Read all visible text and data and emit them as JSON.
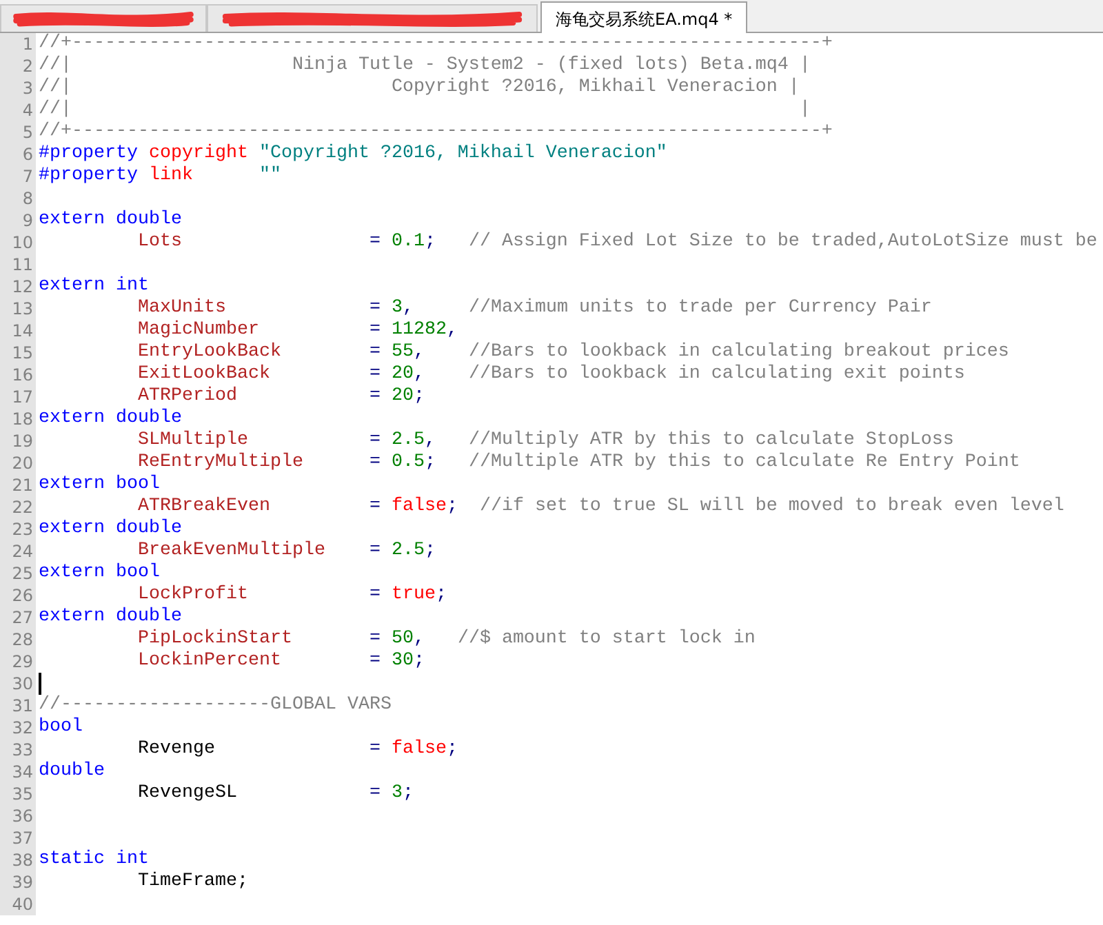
{
  "tabs": [
    {
      "selected": false,
      "redacted": true
    },
    {
      "selected": false,
      "redacted": true
    },
    {
      "label": "海龟交易系统EA.mq4 *",
      "selected": true,
      "redacted": false
    }
  ],
  "editor": {
    "lines": [
      {
        "number": "1",
        "caret": false,
        "tokens": [
          {
            "kind": "comment",
            "text": "//+--------------------------------------------------------------------+"
          }
        ]
      },
      {
        "number": "2",
        "caret": false,
        "tokens": [
          {
            "kind": "comment",
            "text": "//|                    Ninja Tutle - System2 - (fixed lots) Beta.mq4 |"
          }
        ]
      },
      {
        "number": "3",
        "caret": false,
        "tokens": [
          {
            "kind": "comment",
            "text": "//|                             Copyright ?2016, Mikhail Veneracion |"
          }
        ]
      },
      {
        "number": "4",
        "caret": false,
        "tokens": [
          {
            "kind": "comment",
            "text": "//|                                                                  |"
          }
        ]
      },
      {
        "number": "5",
        "caret": false,
        "tokens": [
          {
            "kind": "comment",
            "text": "//+--------------------------------------------------------------------+"
          }
        ]
      },
      {
        "number": "6",
        "caret": false,
        "tokens": [
          {
            "kind": "preproc",
            "text": "#property"
          },
          {
            "kind": "constant",
            "text": " copyright"
          },
          {
            "kind": "string",
            "text": " \"Copyright ?2016, Mikhail Veneracion\""
          }
        ]
      },
      {
        "number": "7",
        "caret": false,
        "tokens": [
          {
            "kind": "preproc",
            "text": "#property"
          },
          {
            "kind": "constant",
            "text": " link"
          },
          {
            "kind": "string",
            "text": "      \"\""
          }
        ]
      },
      {
        "number": "8",
        "caret": false
      },
      {
        "number": "9",
        "caret": false,
        "tokens": [
          {
            "kind": "keyword",
            "text": "extern double"
          }
        ]
      },
      {
        "number": "10",
        "caret": false,
        "tokens": [
          {
            "kind": "var",
            "text": "         Lots"
          },
          {
            "kind": "op",
            "text": "                 = "
          },
          {
            "kind": "number",
            "text": "0.1"
          },
          {
            "kind": "op",
            "text": ";"
          },
          {
            "kind": "comment",
            "text": "   // Assign Fixed Lot Size to be traded,AutoLotSize must be"
          }
        ]
      },
      {
        "number": "11",
        "caret": false
      },
      {
        "number": "12",
        "caret": false,
        "tokens": [
          {
            "kind": "keyword",
            "text": "extern int"
          }
        ]
      },
      {
        "number": "13",
        "caret": false,
        "tokens": [
          {
            "kind": "var",
            "text": "         MaxUnits"
          },
          {
            "kind": "op",
            "text": "             = "
          },
          {
            "kind": "number",
            "text": "3"
          },
          {
            "kind": "op",
            "text": ","
          },
          {
            "kind": "comment",
            "text": "     //Maximum units to trade per Currency Pair"
          }
        ]
      },
      {
        "number": "14",
        "caret": false,
        "tokens": [
          {
            "kind": "var",
            "text": "         MagicNumber"
          },
          {
            "kind": "op",
            "text": "          = "
          },
          {
            "kind": "number",
            "text": "11282"
          },
          {
            "kind": "op",
            "text": ","
          }
        ]
      },
      {
        "number": "15",
        "caret": false,
        "tokens": [
          {
            "kind": "var",
            "text": "         EntryLookBack"
          },
          {
            "kind": "op",
            "text": "        = "
          },
          {
            "kind": "number",
            "text": "55"
          },
          {
            "kind": "op",
            "text": ","
          },
          {
            "kind": "comment",
            "text": "    //Bars to lookback in calculating breakout prices"
          }
        ]
      },
      {
        "number": "16",
        "caret": false,
        "tokens": [
          {
            "kind": "var",
            "text": "         ExitLookBack"
          },
          {
            "kind": "op",
            "text": "         = "
          },
          {
            "kind": "number",
            "text": "20"
          },
          {
            "kind": "op",
            "text": ","
          },
          {
            "kind": "comment",
            "text": "    //Bars to lookback in calculating exit points"
          }
        ]
      },
      {
        "number": "17",
        "caret": false,
        "tokens": [
          {
            "kind": "var",
            "text": "         ATRPeriod"
          },
          {
            "kind": "op",
            "text": "            = "
          },
          {
            "kind": "number",
            "text": "20"
          },
          {
            "kind": "op",
            "text": ";"
          }
        ]
      },
      {
        "number": "18",
        "caret": false,
        "tokens": [
          {
            "kind": "keyword",
            "text": "extern double"
          }
        ]
      },
      {
        "number": "19",
        "caret": false,
        "tokens": [
          {
            "kind": "var",
            "text": "         SLMultiple"
          },
          {
            "kind": "op",
            "text": "           = "
          },
          {
            "kind": "number",
            "text": "2.5"
          },
          {
            "kind": "op",
            "text": ","
          },
          {
            "kind": "comment",
            "text": "   //Multiply ATR by this to calculate StopLoss"
          }
        ]
      },
      {
        "number": "20",
        "caret": false,
        "tokens": [
          {
            "kind": "var",
            "text": "         ReEntryMultiple"
          },
          {
            "kind": "op",
            "text": "      = "
          },
          {
            "kind": "number",
            "text": "0.5"
          },
          {
            "kind": "op",
            "text": ";"
          },
          {
            "kind": "comment",
            "text": "   //Multiple ATR by this to calculate Re Entry Point"
          }
        ]
      },
      {
        "number": "21",
        "caret": false,
        "tokens": [
          {
            "kind": "keyword",
            "text": "extern bool"
          }
        ]
      },
      {
        "number": "22",
        "caret": false,
        "tokens": [
          {
            "kind": "var",
            "text": "         ATRBreakEven"
          },
          {
            "kind": "op",
            "text": "         = "
          },
          {
            "kind": "bool",
            "text": "false"
          },
          {
            "kind": "op",
            "text": ";"
          },
          {
            "kind": "comment",
            "text": "  //if set to true SL will be moved to break even level"
          }
        ]
      },
      {
        "number": "23",
        "caret": false,
        "tokens": [
          {
            "kind": "keyword",
            "text": "extern double"
          }
        ]
      },
      {
        "number": "24",
        "caret": false,
        "tokens": [
          {
            "kind": "var",
            "text": "         BreakEvenMultiple"
          },
          {
            "kind": "op",
            "text": "    = "
          },
          {
            "kind": "number",
            "text": "2.5"
          },
          {
            "kind": "op",
            "text": ";"
          }
        ]
      },
      {
        "number": "25",
        "caret": false,
        "tokens": [
          {
            "kind": "keyword",
            "text": "extern bool"
          }
        ]
      },
      {
        "number": "26",
        "caret": false,
        "tokens": [
          {
            "kind": "var",
            "text": "         LockProfit"
          },
          {
            "kind": "op",
            "text": "           = "
          },
          {
            "kind": "bool",
            "text": "true"
          },
          {
            "kind": "op",
            "text": ";"
          }
        ]
      },
      {
        "number": "27",
        "caret": false,
        "tokens": [
          {
            "kind": "keyword",
            "text": "extern double"
          }
        ]
      },
      {
        "number": "28",
        "caret": false,
        "tokens": [
          {
            "kind": "var",
            "text": "         PipLockinStart"
          },
          {
            "kind": "op",
            "text": "       = "
          },
          {
            "kind": "number",
            "text": "50"
          },
          {
            "kind": "op",
            "text": ","
          },
          {
            "kind": "comment",
            "text": "   //$ amount to start lock in"
          }
        ]
      },
      {
        "number": "29",
        "caret": false,
        "tokens": [
          {
            "kind": "var",
            "text": "         LockinPercent"
          },
          {
            "kind": "op",
            "text": "        = "
          },
          {
            "kind": "number",
            "text": "30"
          },
          {
            "kind": "op",
            "text": ";"
          }
        ]
      },
      {
        "number": "30",
        "caret": true
      },
      {
        "number": "31",
        "caret": false,
        "tokens": [
          {
            "kind": "comment",
            "text": "//-------------------GLOBAL VARS"
          }
        ]
      },
      {
        "number": "32",
        "caret": false,
        "tokens": [
          {
            "kind": "keyword",
            "text": "bool"
          }
        ]
      },
      {
        "number": "33",
        "caret": false,
        "tokens": [
          {
            "kind": "plain",
            "text": "         Revenge"
          },
          {
            "kind": "op",
            "text": "              = "
          },
          {
            "kind": "bool",
            "text": "false"
          },
          {
            "kind": "op",
            "text": ";"
          }
        ]
      },
      {
        "number": "34",
        "caret": false,
        "tokens": [
          {
            "kind": "keyword",
            "text": "double"
          }
        ]
      },
      {
        "number": "35",
        "caret": false,
        "tokens": [
          {
            "kind": "plain",
            "text": "         RevengeSL"
          },
          {
            "kind": "op",
            "text": "            = "
          },
          {
            "kind": "number",
            "text": "3"
          },
          {
            "kind": "op",
            "text": ";"
          }
        ]
      },
      {
        "number": "36",
        "caret": false
      },
      {
        "number": "37",
        "caret": false
      },
      {
        "number": "38",
        "caret": false,
        "tokens": [
          {
            "kind": "keyword",
            "text": "static int"
          }
        ]
      },
      {
        "number": "39",
        "caret": false,
        "tokens": [
          {
            "kind": "plain",
            "text": "         TimeFrame;"
          }
        ]
      },
      {
        "number": "40",
        "caret": false
      }
    ]
  }
}
